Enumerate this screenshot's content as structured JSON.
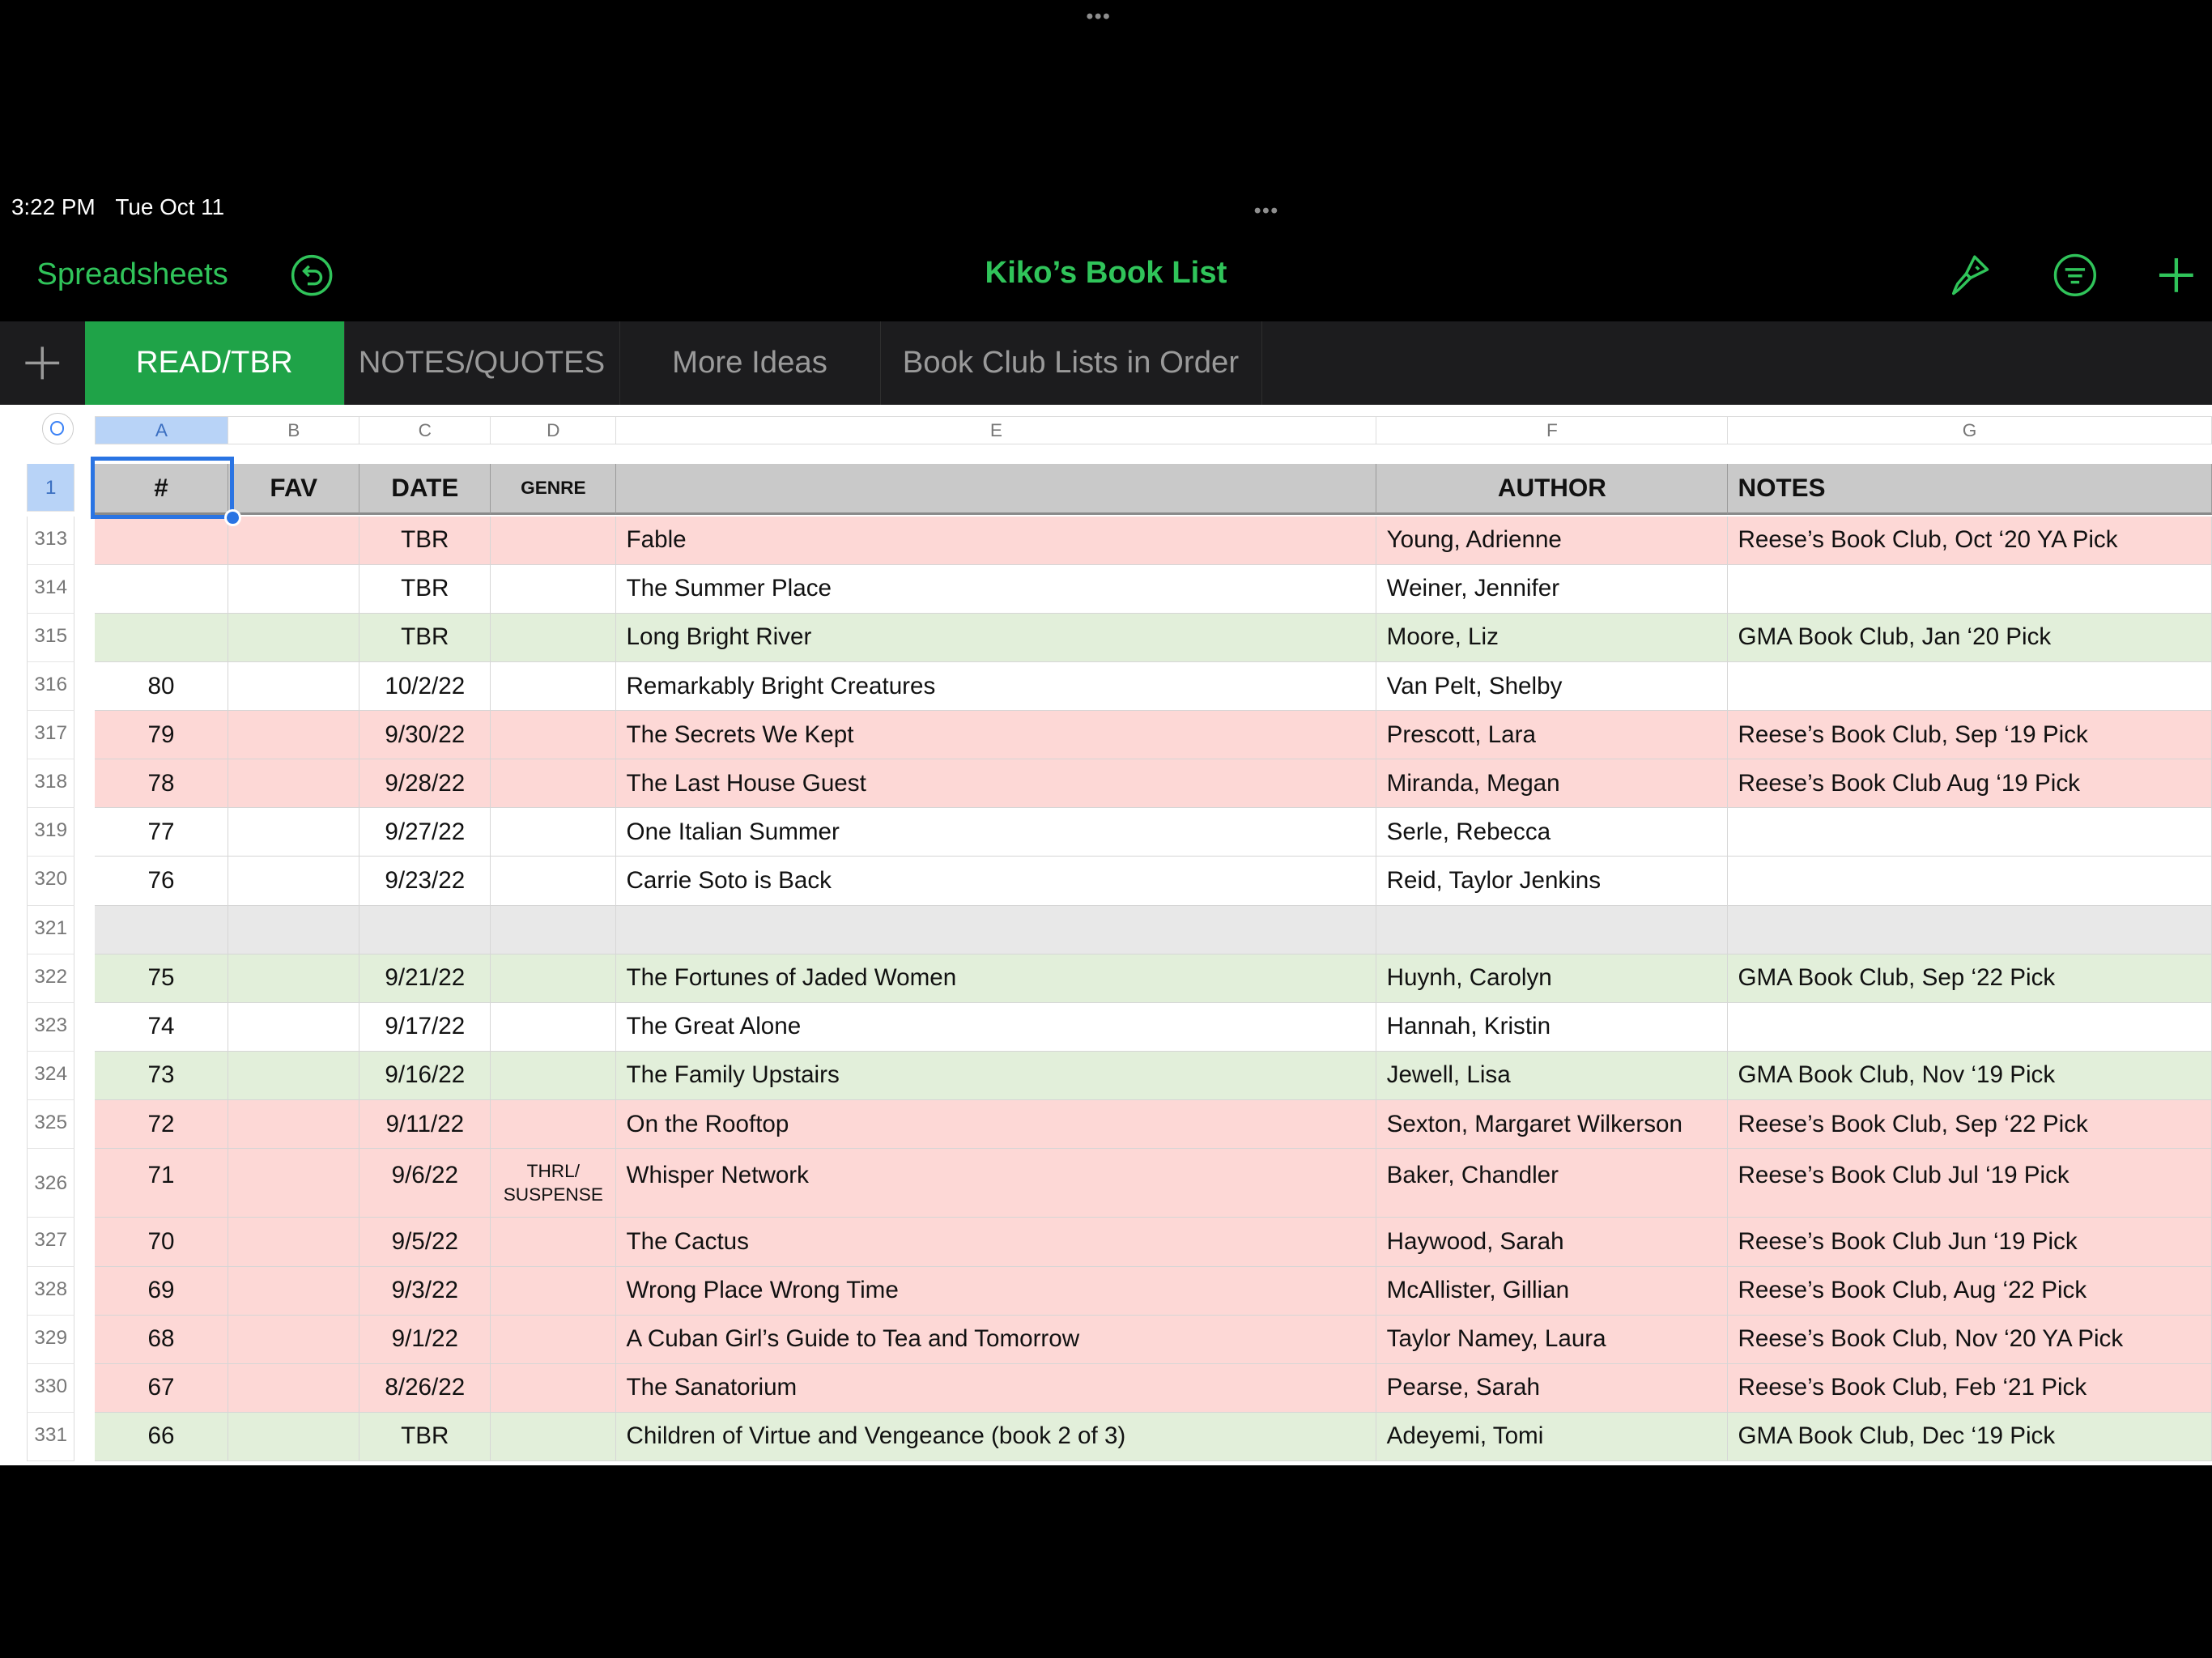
{
  "status_bar": {
    "time": "3:22 PM",
    "date": "Tue Oct 11"
  },
  "toolbar": {
    "back_label": "Spreadsheets",
    "title": "Kiko’s Book List",
    "accent_color": "#30c45a"
  },
  "tabs": [
    {
      "label": "READ/TBR",
      "active": true
    },
    {
      "label": "NOTES/QUOTES",
      "active": false
    },
    {
      "label": "More Ideas",
      "active": false
    },
    {
      "label": "Book Club Lists in Order",
      "active": false
    }
  ],
  "columns": [
    "A",
    "B",
    "C",
    "D",
    "E",
    "F",
    "G"
  ],
  "header": {
    "row_number": "1",
    "num": "#",
    "fav": "FAV",
    "date": "DATE",
    "genre": "GENRE",
    "title": "",
    "author": "AUTHOR",
    "notes": "NOTES"
  },
  "rows": [
    {
      "n": "313",
      "num": "",
      "date": "TBR",
      "genre": "",
      "title": "Fable",
      "author": "Young, Adrienne",
      "notes": "Reese’s Book Club, Oct ‘20 YA Pick",
      "color": "pink"
    },
    {
      "n": "314",
      "num": "",
      "date": "TBR",
      "genre": "",
      "title": "The Summer Place",
      "author": "Weiner, Jennifer",
      "notes": "",
      "color": "white"
    },
    {
      "n": "315",
      "num": "",
      "date": "TBR",
      "genre": "",
      "title": "Long Bright River",
      "author": "Moore, Liz",
      "notes": "GMA Book Club, Jan ‘20 Pick",
      "color": "green"
    },
    {
      "n": "316",
      "num": "80",
      "date": "10/2/22",
      "genre": "",
      "title": "Remarkably Bright Creatures",
      "author": "Van Pelt, Shelby",
      "notes": "",
      "color": "white"
    },
    {
      "n": "317",
      "num": "79",
      "date": "9/30/22",
      "genre": "",
      "title": "The Secrets We Kept",
      "author": "Prescott, Lara",
      "notes": "Reese’s Book Club, Sep ‘19 Pick",
      "color": "pink"
    },
    {
      "n": "318",
      "num": "78",
      "date": "9/28/22",
      "genre": "",
      "title": "The Last House Guest",
      "author": "Miranda, Megan",
      "notes": "Reese’s Book Club Aug ‘19 Pick",
      "color": "pink"
    },
    {
      "n": "319",
      "num": "77",
      "date": "9/27/22",
      "genre": "",
      "title": "One Italian Summer",
      "author": "Serle, Rebecca",
      "notes": "",
      "color": "white"
    },
    {
      "n": "320",
      "num": "76",
      "date": "9/23/22",
      "genre": "",
      "title": "Carrie Soto is Back",
      "author": "Reid, Taylor Jenkins",
      "notes": "",
      "color": "white"
    },
    {
      "n": "321",
      "num": "",
      "date": "",
      "genre": "",
      "title": "",
      "author": "",
      "notes": "",
      "color": "gray"
    },
    {
      "n": "322",
      "num": "75",
      "date": "9/21/22",
      "genre": "",
      "title": "The Fortunes of Jaded Women",
      "author": "Huynh, Carolyn",
      "notes": "GMA Book Club, Sep ‘22 Pick",
      "color": "green"
    },
    {
      "n": "323",
      "num": "74",
      "date": "9/17/22",
      "genre": "",
      "title": "The Great Alone",
      "author": "Hannah, Kristin",
      "notes": "",
      "color": "white"
    },
    {
      "n": "324",
      "num": "73",
      "date": "9/16/22",
      "genre": "",
      "title": "The Family Upstairs",
      "author": "Jewell, Lisa",
      "notes": "GMA Book Club, Nov ‘19 Pick",
      "color": "green"
    },
    {
      "n": "325",
      "num": "72",
      "date": "9/11/22",
      "genre": "",
      "title": "On the Rooftop",
      "author": "Sexton, Margaret Wilkerson",
      "notes": "Reese’s Book Club, Sep ‘22 Pick",
      "color": "pink"
    },
    {
      "n": "326",
      "num": "71",
      "date": "9/6/22",
      "genre": "THRL/ SUSPENSE",
      "title": "Whisper Network",
      "author": "Baker, Chandler",
      "notes": "Reese’s Book Club Jul ‘19 Pick",
      "color": "pink"
    },
    {
      "n": "327",
      "num": "70",
      "date": "9/5/22",
      "genre": "",
      "title": "The Cactus",
      "author": "Haywood, Sarah",
      "notes": "Reese’s Book Club Jun ‘19 Pick",
      "color": "pink"
    },
    {
      "n": "328",
      "num": "69",
      "date": "9/3/22",
      "genre": "",
      "title": "Wrong Place Wrong Time",
      "author": "McAllister, Gillian",
      "notes": "Reese’s Book Club, Aug ‘22 Pick",
      "color": "pink"
    },
    {
      "n": "329",
      "num": "68",
      "date": "9/1/22",
      "genre": "",
      "title": "A Cuban Girl’s Guide to Tea and Tomorrow",
      "author": "Taylor Namey, Laura",
      "notes": "Reese’s Book Club, Nov ‘20 YA Pick",
      "color": "pink"
    },
    {
      "n": "330",
      "num": "67",
      "date": "8/26/22",
      "genre": "",
      "title": "The Sanatorium",
      "author": "Pearse, Sarah",
      "notes": "Reese’s Book Club, Feb ‘21 Pick",
      "color": "pink"
    },
    {
      "n": "331",
      "num": "66",
      "date": "TBR",
      "genre": "",
      "title": "Children of Virtue and Vengeance (book 2 of 3)",
      "author": "Adeyemi, Tomi",
      "notes": "GMA Book Club, Dec ‘19 Pick",
      "color": "green"
    }
  ]
}
